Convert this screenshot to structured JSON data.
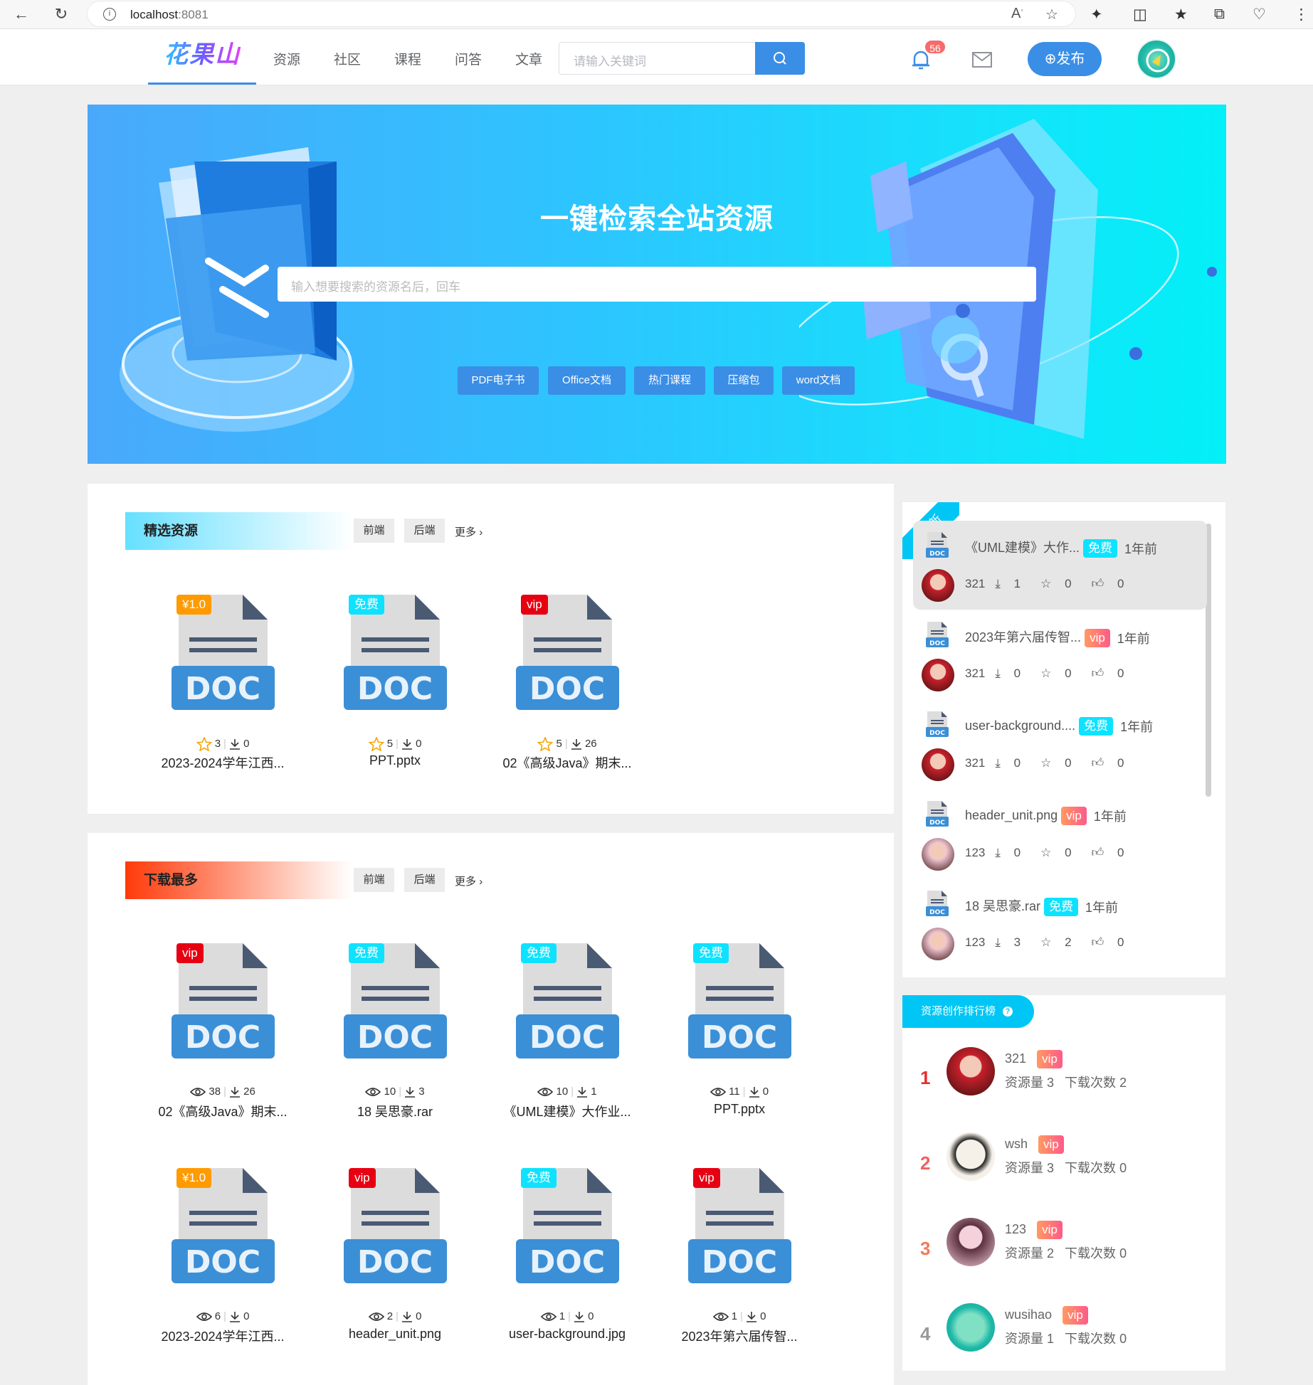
{
  "browser": {
    "url_host": "localhost",
    "url_port": ":8081"
  },
  "nav": {
    "logo": "花果山",
    "items": [
      "资源",
      "社区",
      "课程",
      "问答",
      "文章"
    ],
    "search_placeholder": "请输入关键词",
    "notification_count": "56",
    "publish_label": "发布",
    "accent": "#3a8ee6"
  },
  "banner": {
    "title": "一键检索全站资源",
    "search_placeholder": "输入想要搜索的资源名后，回车",
    "tags": [
      "PDF电子书",
      "Office文档",
      "热门课程",
      "压缩包",
      "word文档"
    ]
  },
  "featured": {
    "title": "精选资源",
    "chips": [
      "前端",
      "后端"
    ],
    "more": "更多",
    "files": [
      {
        "tag": "¥1.0",
        "tag_type": "price",
        "stat1": "3",
        "stat2": "0",
        "name": "2023-2024学年江西..."
      },
      {
        "tag": "免费",
        "tag_type": "free",
        "stat1": "5",
        "stat2": "0",
        "name": "PPT.pptx"
      },
      {
        "tag": "vip",
        "tag_type": "vip",
        "stat1": "5",
        "stat2": "26",
        "name": "02《高级Java》期末..."
      }
    ]
  },
  "most_downloaded": {
    "title": "下载最多",
    "chips": [
      "前端",
      "后端"
    ],
    "more": "更多",
    "files": [
      {
        "tag": "vip",
        "tag_type": "vip",
        "stat1": "38",
        "stat2": "26",
        "name": "02《高级Java》期末..."
      },
      {
        "tag": "免费",
        "tag_type": "free",
        "stat1": "10",
        "stat2": "3",
        "name": "18 吴思豪.rar"
      },
      {
        "tag": "免费",
        "tag_type": "free",
        "stat1": "10",
        "stat2": "1",
        "name": "《UML建模》大作业..."
      },
      {
        "tag": "免费",
        "tag_type": "free",
        "stat1": "11",
        "stat2": "0",
        "name": "PPT.pptx"
      },
      {
        "tag": "¥1.0",
        "tag_type": "price",
        "stat1": "6",
        "stat2": "0",
        "name": "2023-2024学年江西..."
      },
      {
        "tag": "vip",
        "tag_type": "vip",
        "stat1": "2",
        "stat2": "0",
        "name": "header_unit.png"
      },
      {
        "tag": "免费",
        "tag_type": "free",
        "stat1": "1",
        "stat2": "0",
        "name": "user-background.jpg"
      },
      {
        "tag": "vip",
        "tag_type": "vip",
        "stat1": "1",
        "stat2": "0",
        "name": "2023年第六届传智..."
      }
    ]
  },
  "latest": {
    "ribbon": "最新",
    "items": [
      {
        "title": "《UML建模》大作...",
        "tag": "免费",
        "tag_type": "free",
        "time": "1年前",
        "user": "321",
        "downloads": "1",
        "stars": "0",
        "likes": "0"
      },
      {
        "title": "2023年第六届传智...",
        "tag": "vip",
        "tag_type": "vip",
        "time": "1年前",
        "user": "321",
        "downloads": "0",
        "stars": "0",
        "likes": "0"
      },
      {
        "title": "user-background....",
        "tag": "免费",
        "tag_type": "free",
        "time": "1年前",
        "user": "321",
        "downloads": "0",
        "stars": "0",
        "likes": "0"
      },
      {
        "title": "header_unit.png",
        "tag": "vip",
        "tag_type": "vip",
        "time": "1年前",
        "user": "123",
        "downloads": "0",
        "stars": "0",
        "likes": "0"
      },
      {
        "title": "18 吴思豪.rar",
        "tag": "免费",
        "tag_type": "free",
        "time": "1年前",
        "user": "123",
        "downloads": "3",
        "stars": "2",
        "likes": "0"
      }
    ]
  },
  "ranking": {
    "title": "资源创作排行榜",
    "items": [
      {
        "rank": "1",
        "name": "321",
        "badge": "vip",
        "resources_label": "资源量",
        "resources": "3",
        "downloads_label": "下载次数",
        "downloads": "2",
        "rank_color": "#e62e2e"
      },
      {
        "rank": "2",
        "name": "wsh",
        "badge": "vip",
        "resources_label": "资源量",
        "resources": "3",
        "downloads_label": "下载次数",
        "downloads": "0",
        "rank_color": "#f06262"
      },
      {
        "rank": "3",
        "name": "123",
        "badge": "vip",
        "resources_label": "资源量",
        "resources": "2",
        "downloads_label": "下载次数",
        "downloads": "0",
        "rank_color": "#f07c5c"
      },
      {
        "rank": "4",
        "name": "wusihao",
        "badge": "vip",
        "resources_label": "资源量",
        "resources": "1",
        "downloads_label": "下载次数",
        "downloads": "0",
        "rank_color": "#999999"
      }
    ]
  }
}
